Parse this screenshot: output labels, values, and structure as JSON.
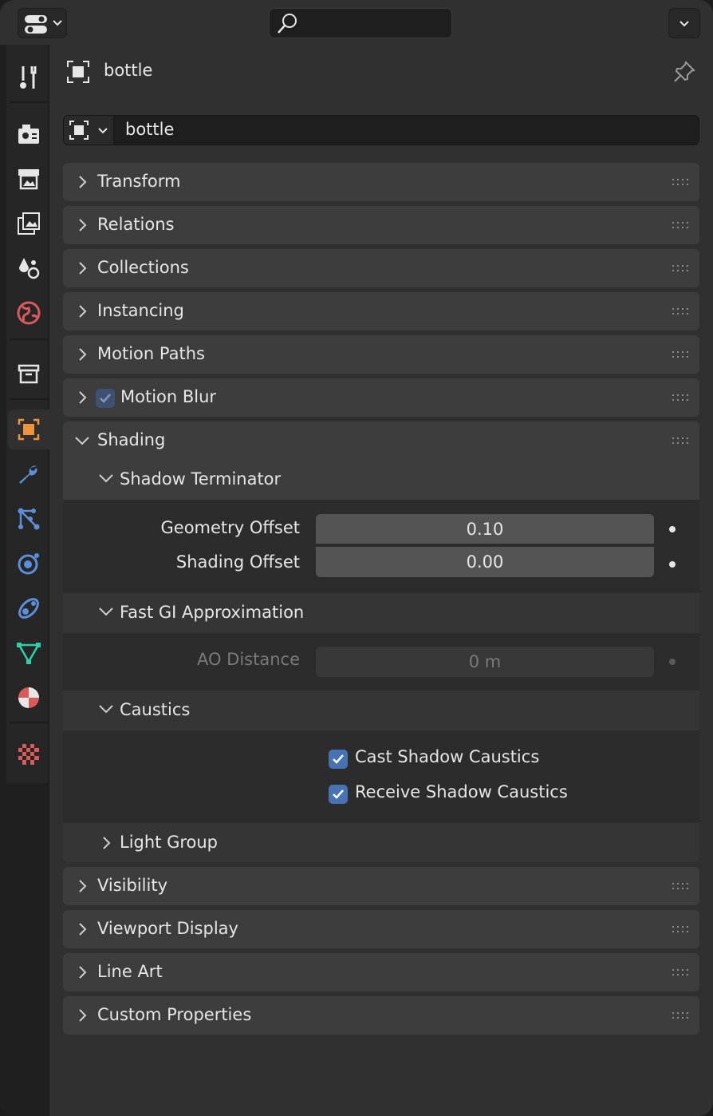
{
  "header": {
    "object_name": "bottle"
  },
  "datablock": {
    "name": "bottle"
  },
  "panels": [
    {
      "label": "Transform"
    },
    {
      "label": "Relations"
    },
    {
      "label": "Collections"
    },
    {
      "label": "Instancing"
    },
    {
      "label": "Motion Paths"
    },
    {
      "label": "Motion Blur",
      "checkbox": true
    },
    {
      "label": "Shading",
      "expanded": true
    }
  ],
  "shading": {
    "shadow_terminator": {
      "label": "Shadow Terminator",
      "geometry_offset": {
        "label": "Geometry Offset",
        "value": "0.10"
      },
      "shading_offset": {
        "label": "Shading Offset",
        "value": "0.00"
      }
    },
    "fast_gi": {
      "label": "Fast GI Approximation",
      "ao_distance": {
        "label": "AO Distance",
        "value": "0 m"
      }
    },
    "caustics": {
      "label": "Caustics",
      "cast": {
        "label": "Cast Shadow Caustics",
        "checked": true
      },
      "receive": {
        "label": "Receive Shadow Caustics",
        "checked": true
      }
    },
    "light_group": {
      "label": "Light Group"
    }
  },
  "lower_panels": [
    {
      "label": "Visibility"
    },
    {
      "label": "Viewport Display"
    },
    {
      "label": "Line Art"
    },
    {
      "label": "Custom Properties"
    }
  ],
  "colors": {
    "accent_orange": "#f0943c",
    "checkbox_blue": "#4772b3",
    "modifier_blue": "#5b8fd9",
    "data_green": "#2bd1a8",
    "world_red": "#d85a5a"
  },
  "tabs": [
    "tool-icon",
    "render-icon",
    "output-icon",
    "view-layer-icon",
    "scene-icon",
    "world-icon",
    "collection-icon",
    "object-icon",
    "modifier-icon",
    "particles-icon",
    "physics-icon",
    "constraints-icon",
    "data-icon",
    "material-icon",
    "texture-icon"
  ]
}
